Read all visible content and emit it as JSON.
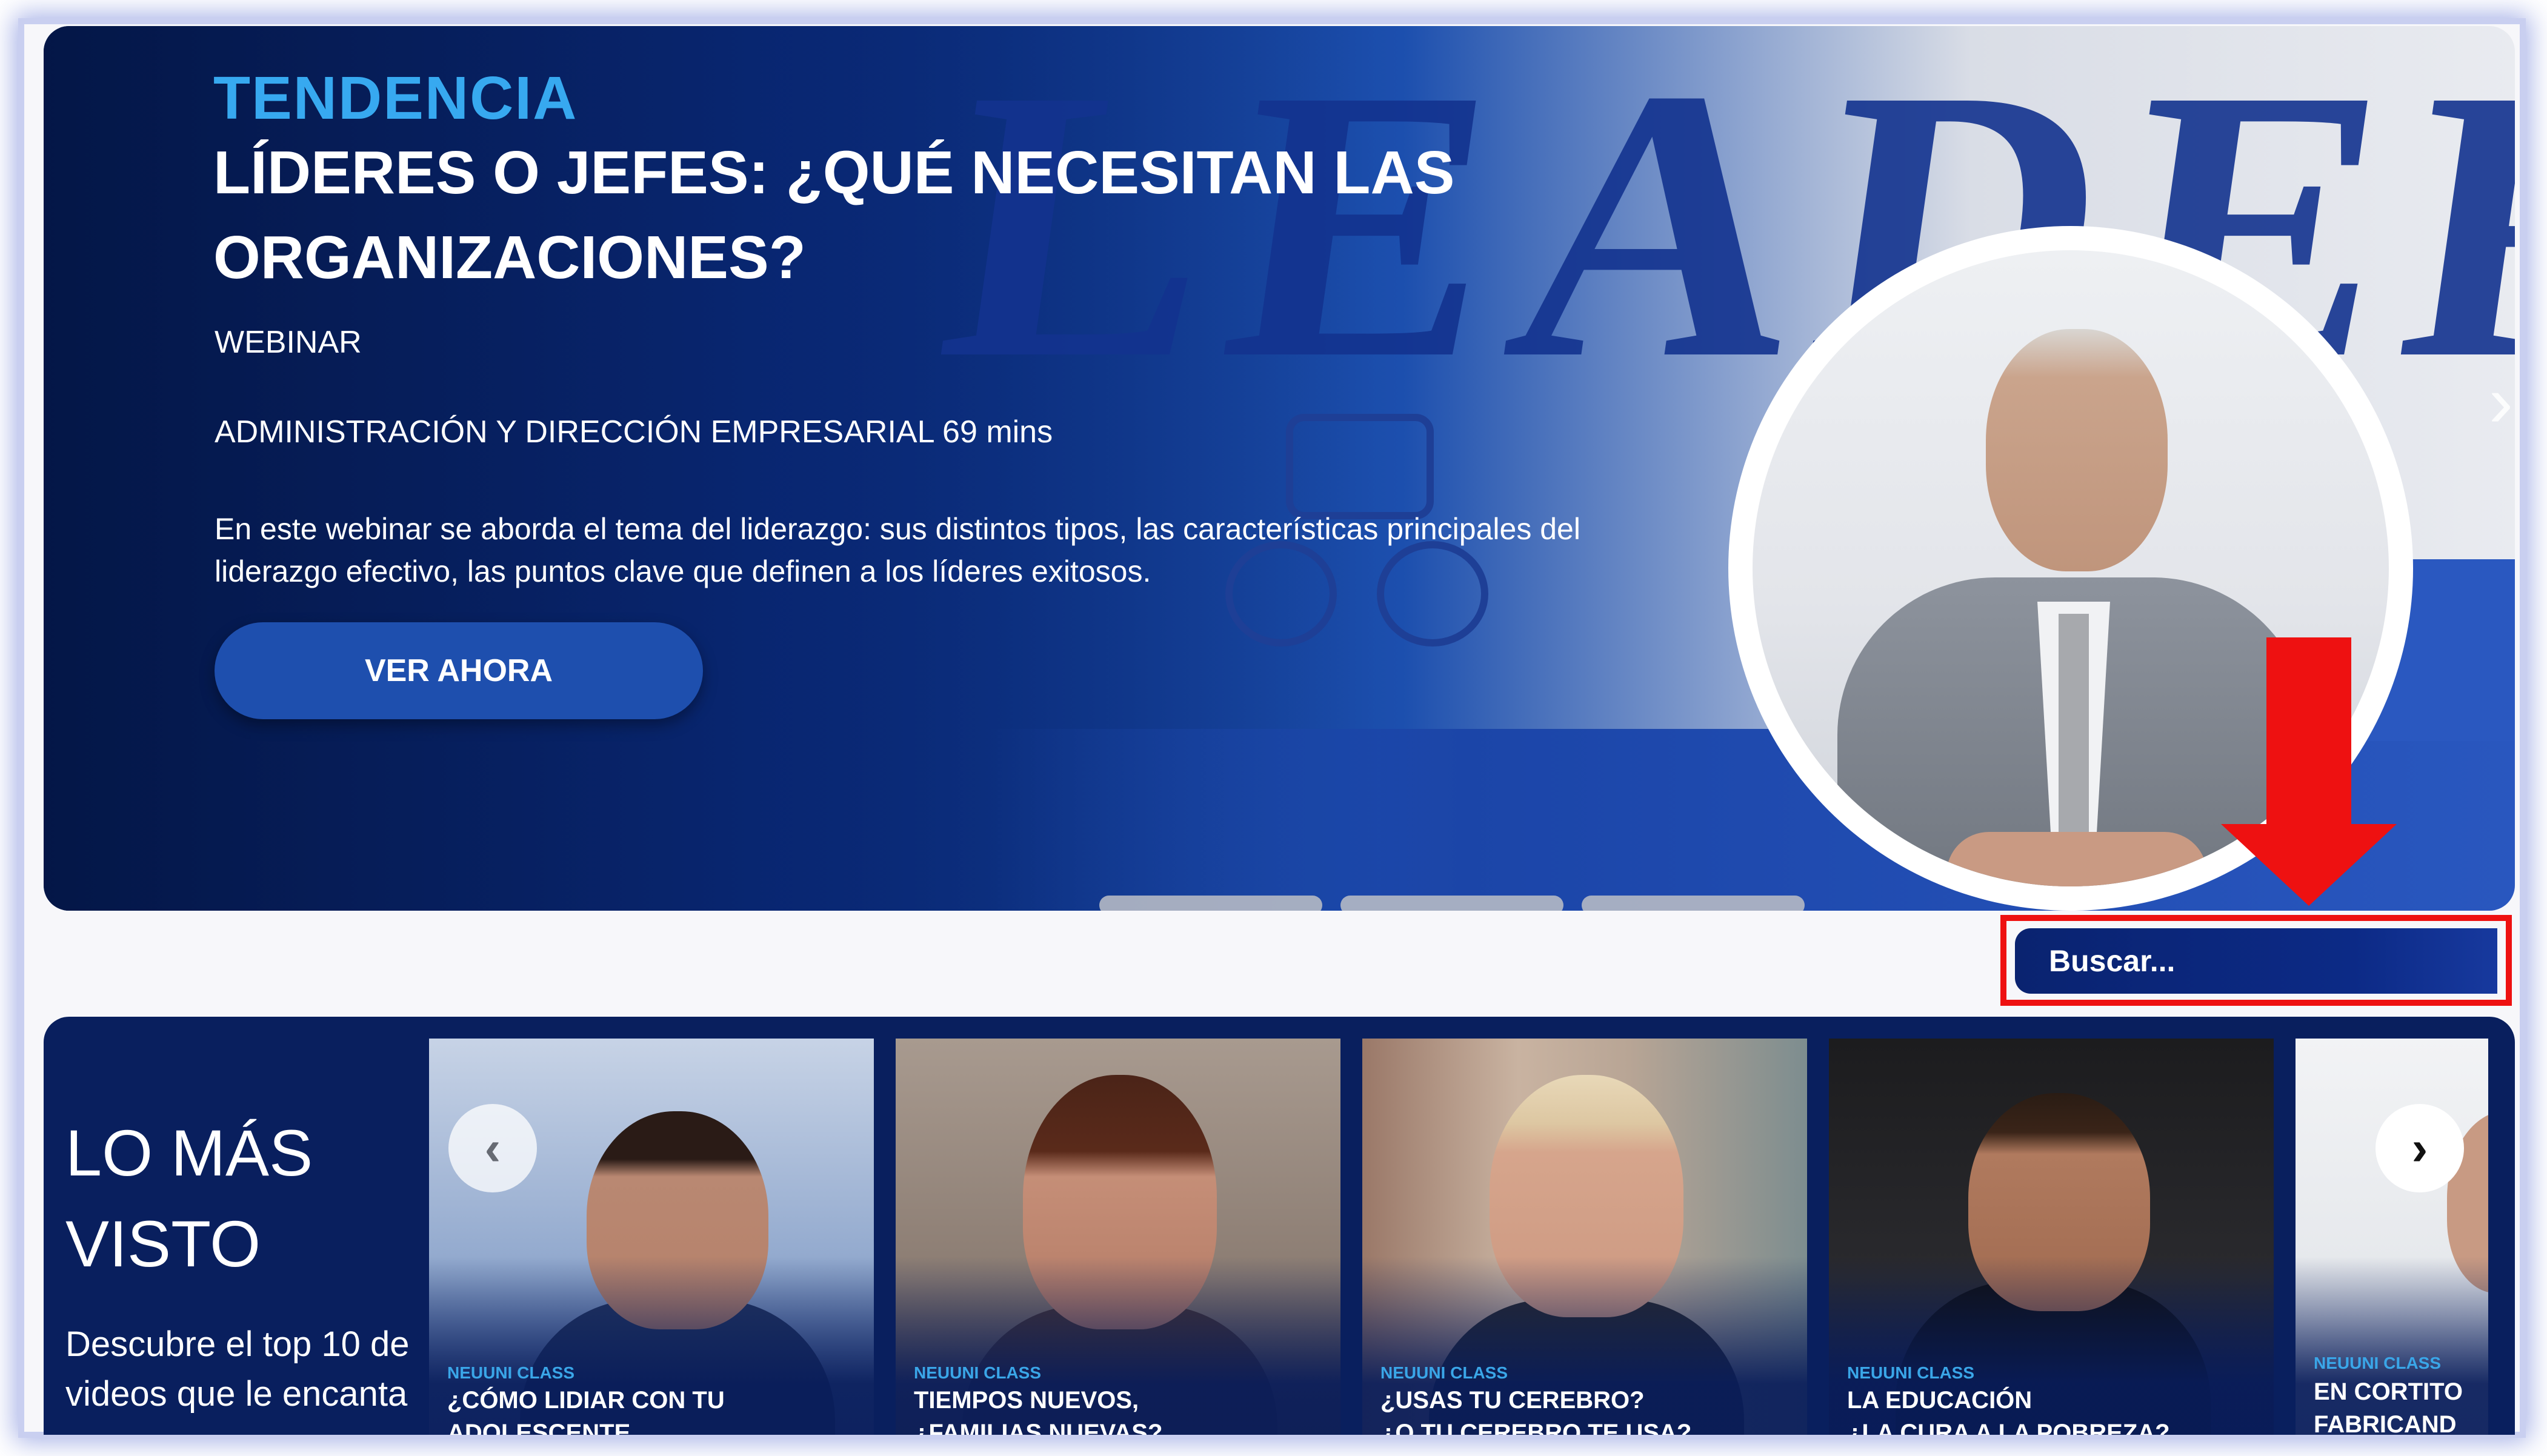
{
  "hero": {
    "tag": "TENDENCIA",
    "title": "LÍDERES O JEFES: ¿QUÉ NECESITAN LAS ORGANIZACIONES?",
    "type": "WEBINAR",
    "category": "ADMINISTRACIÓN Y DIRECCIÓN EMPRESARIAL 69 mins",
    "description": "En este webinar se aborda el tema del liderazgo: sus distintos tipos, las características principales del liderazgo efectivo, las puntos clave que definen a los líderes exitosos.",
    "cta": "VER AHORA",
    "background_word": "LEADER",
    "next_icon": "chevron-right-icon",
    "slides": 3
  },
  "search": {
    "placeholder": "Buscar..."
  },
  "annotation": {
    "color": "#ee1111",
    "arrow_icon": "down-arrow-icon"
  },
  "most_viewed": {
    "title": "LO MÁS VISTO",
    "description": "Descubre el top 10 de videos que le encanta",
    "prev_icon": "chevron-left-icon",
    "next_icon": "chevron-right-icon",
    "cards": [
      {
        "category": "NEUUNI CLASS",
        "title": "¿CÓMO LIDIAR CON TU\nADOLESCENTE INCOMPRENSIBLE?"
      },
      {
        "category": "NEUUNI CLASS",
        "title": "TIEMPOS NUEVOS,\n¿FAMILIAS NUEVAS?"
      },
      {
        "category": "NEUUNI CLASS",
        "title": "¿USAS TU CEREBRO?\n¿O TU CEREBRO TE USA?"
      },
      {
        "category": "NEUUNI CLASS",
        "title": "LA EDUCACIÓN\n¿LA CURA A LA POBREZA?"
      },
      {
        "category": "NEUUNI CLASS",
        "title": "EN CORTITO\nFABRICAND"
      }
    ]
  },
  "colors": {
    "accent": "#37a9f0",
    "navy": "#091f5e",
    "button": "#1e4fae"
  }
}
